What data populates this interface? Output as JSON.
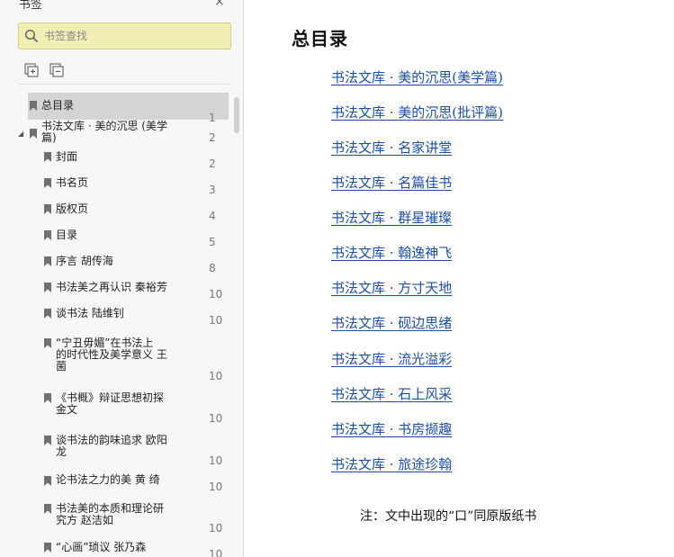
{
  "sidebar": {
    "title": "书签",
    "close_symbol": "×",
    "search": {
      "value": "",
      "placeholder": "书签查找"
    },
    "items": [
      {
        "label": "总目录",
        "page": "1",
        "selected": true,
        "level": 0
      },
      {
        "label": "书法文库 · 美的沉思 (美学\n篇)",
        "page": "2",
        "expanded": true,
        "level": 0
      },
      {
        "label": "封面",
        "page": "2",
        "level": 1
      },
      {
        "label": "书名页",
        "page": "3",
        "level": 1
      },
      {
        "label": "版权页",
        "page": "4",
        "level": 1
      },
      {
        "label": "目录",
        "page": "5",
        "level": 1
      },
      {
        "label": "序言  胡传海",
        "page": "8",
        "level": 1
      },
      {
        "label": "书法美之再认识  秦裕芳",
        "page": "10",
        "level": 1
      },
      {
        "label": "谈书法  陆维钊",
        "page": "10",
        "level": 1
      },
      {
        "label": "“宁丑毋媚”在书法上\n的时代性及美学意义  王\n菌",
        "page": "10",
        "level": 1
      },
      {
        "label": "《书概》辩证思想初探\n金文",
        "page": "10",
        "level": 1
      },
      {
        "label": "谈书法的韵味追求  欧阳\n龙",
        "page": "10",
        "level": 1
      },
      {
        "label": "论书法之力的美  黄  绮",
        "page": "10",
        "level": 1
      },
      {
        "label": "书法美的本质和理论研\n究方  赵洁如",
        "page": "10",
        "level": 1
      },
      {
        "label": "“心画”琐议  张乃森",
        "page": "10",
        "level": 1
      }
    ]
  },
  "document": {
    "title": "总目录",
    "links": [
      "书法文库 · 美的沉思(美学篇)",
      "书法文库 · 美的沉思(批评篇)",
      "书法文库 · 名家讲堂",
      "书法文库 · 名篇佳书",
      "书法文库 · 群星璀璨",
      "书法文库 · 翰逸神飞",
      "书法文库 · 方寸天地",
      "书法文库 · 砚边思绪",
      "书法文库 · 流光溢彩",
      "书法文库 · 石上风采",
      "书法文库 · 书房撷趣",
      "书法文库 · 旅途珍翰"
    ],
    "note": "注：文中出现的“口”同原版纸书"
  },
  "colors": {
    "search_bg": "#f2efb4",
    "selected_row": "#d4d4d4",
    "link": "#1d4fa5",
    "bookmark_icon": "#707070"
  }
}
